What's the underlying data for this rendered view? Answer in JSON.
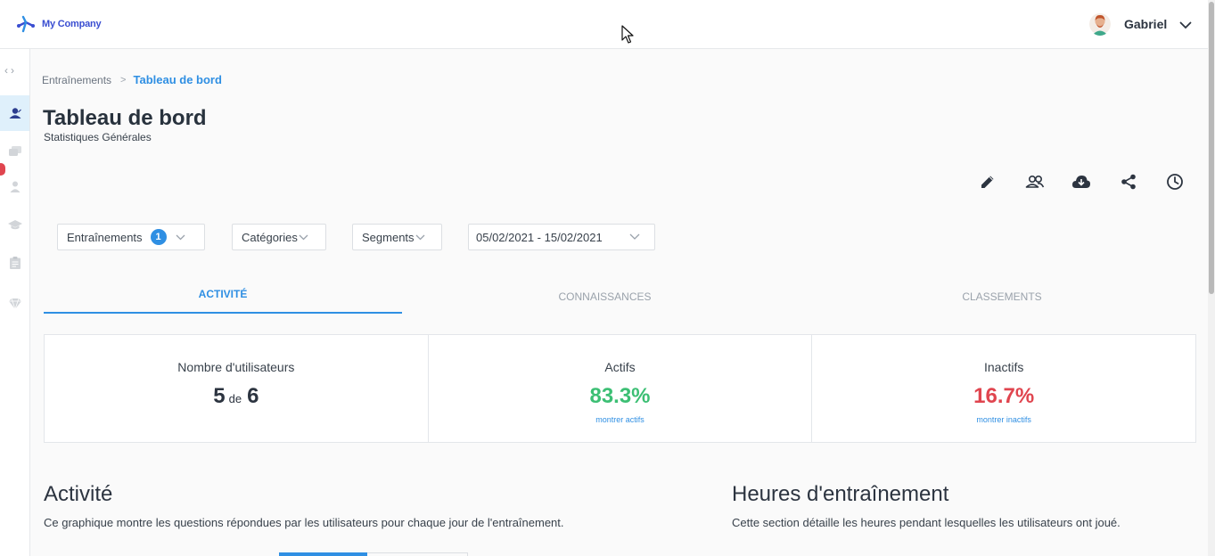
{
  "app": {
    "company_name": "My Company"
  },
  "user": {
    "name": "Gabriel"
  },
  "sidebar": {
    "items": [
      {
        "icon": "users-dashboard-icon",
        "active": true
      },
      {
        "icon": "chat-icon",
        "active": false
      },
      {
        "icon": "person-icon",
        "active": false
      },
      {
        "icon": "graduation-cap-icon",
        "active": false
      },
      {
        "icon": "clipboard-icon",
        "active": false
      },
      {
        "icon": "trophy-icon",
        "active": false
      }
    ]
  },
  "breadcrumb": {
    "root": "Entraînements",
    "current": "Tableau de bord"
  },
  "page": {
    "title": "Tableau de bord",
    "subtitle": "Statistiques Générales"
  },
  "toolbar": {
    "icons": [
      "edit-icon",
      "group-icon",
      "cloud-download-icon",
      "share-icon",
      "history-icon"
    ]
  },
  "filters": {
    "trainings_label": "Entraînements",
    "trainings_count": "1",
    "categories_label": "Catégories",
    "segments_label": "Segments",
    "date_range": "05/02/2021 - 15/02/2021"
  },
  "tabs": {
    "activity": "ACTIVITÉ",
    "knowledge": "CONNAISSANCES",
    "rankings": "CLASSEMENTS"
  },
  "stats": {
    "users": {
      "label": "Nombre d'utilisateurs",
      "value": "5",
      "connector": "de",
      "total": "6"
    },
    "active": {
      "label": "Actifs",
      "value": "83.3%",
      "link": "montrer actifs"
    },
    "inactive": {
      "label": "Inactifs",
      "value": "16.7%",
      "link": "montrer inactifs"
    }
  },
  "sections": {
    "activity": {
      "title": "Activité",
      "desc": "Ce graphique montre les questions répondues par les utilisateurs pour chaque jour de l'entraînement."
    },
    "hours": {
      "title": "Heures d'entraînement",
      "desc": "Cette section détaille les heures pendant lesquelles les utilisateurs ont joué."
    }
  },
  "colors": {
    "accent": "#2f8fe3",
    "positive": "#3cbf74",
    "negative": "#e0454f"
  }
}
